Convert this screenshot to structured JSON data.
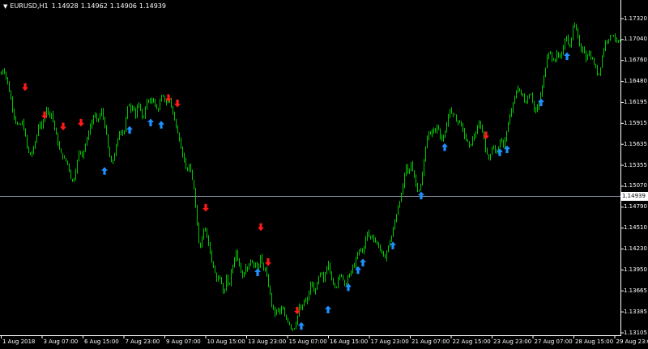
{
  "header": {
    "symbol": "EURUSD,H1",
    "open": "1.14928",
    "high": "1.14962",
    "low": "1.14906",
    "close": "1.14939"
  },
  "colors": {
    "background": "#000000",
    "candles": "#00c800",
    "bid_line": "#8a93a8",
    "sell_arrow": "#ff1a1a",
    "buy_arrow": "#1e90ff",
    "axis_text": "#ffffff"
  },
  "bid_price_label": "1.14939",
  "chart_data": {
    "type": "line",
    "x_tick_labels": [
      "1 Aug 2018",
      "3 Aug 07:00",
      "6 Aug 15:00",
      "7 Aug 23:00",
      "9 Aug 07:00",
      "10 Aug 15:00",
      "13 Aug 23:00",
      "15 Aug 07:00",
      "16 Aug 15:00",
      "17 Aug 23:00",
      "21 Aug 07:00",
      "22 Aug 15:00",
      "23 Aug 23:00",
      "27 Aug 07:00",
      "28 Aug 15:00",
      "29 Aug 23:00"
    ],
    "y_tick_labels": [
      "1.17320",
      "1.17040",
      "1.16760",
      "1.16480",
      "1.16195",
      "1.15915",
      "1.15635",
      "1.15355",
      "1.15070",
      "1.14790",
      "1.14510",
      "1.14230",
      "1.13950",
      "1.13665",
      "1.13385",
      "1.13105"
    ],
    "ylim": [
      1.13105,
      1.1732
    ],
    "bid_line": 1.14939,
    "price_path": [
      [
        0,
        1.1657
      ],
      [
        4,
        1.1665
      ],
      [
        8,
        1.165
      ],
      [
        12,
        1.163
      ],
      [
        16,
        1.1605
      ],
      [
        20,
        1.159
      ],
      [
        24,
        1.1588
      ],
      [
        27,
        1.1593
      ],
      [
        30,
        1.158
      ],
      [
        33,
        1.156
      ],
      [
        36,
        1.1548
      ],
      [
        39,
        1.1552
      ],
      [
        42,
        1.1562
      ],
      [
        45,
        1.1575
      ],
      [
        48,
        1.1595
      ],
      [
        51,
        1.1585
      ],
      [
        54,
        1.1598
      ],
      [
        57,
        1.1613
      ],
      [
        60,
        1.1602
      ],
      [
        63,
        1.1605
      ],
      [
        66,
        1.159
      ],
      [
        70,
        1.157
      ],
      [
        74,
        1.1552
      ],
      [
        78,
        1.1545
      ],
      [
        82,
        1.154
      ],
      [
        85,
        1.153
      ],
      [
        88,
        1.1512
      ],
      [
        91,
        1.1518
      ],
      [
        94,
        1.1535
      ],
      [
        98,
        1.1558
      ],
      [
        101,
        1.1548
      ],
      [
        104,
        1.156
      ],
      [
        107,
        1.157
      ],
      [
        110,
        1.1585
      ],
      [
        113,
        1.1593
      ],
      [
        116,
        1.1605
      ],
      [
        119,
        1.1595
      ],
      [
        122,
        1.16
      ],
      [
        125,
        1.1608
      ],
      [
        128,
        1.1595
      ],
      [
        131,
        1.1575
      ],
      [
        134,
        1.155
      ],
      [
        137,
        1.1538
      ],
      [
        140,
        1.1545
      ],
      [
        143,
        1.156
      ],
      [
        146,
        1.1575
      ],
      [
        149,
        1.1583
      ],
      [
        152,
        1.1575
      ],
      [
        155,
        1.1598
      ],
      [
        158,
        1.162
      ],
      [
        161,
        1.161
      ],
      [
        164,
        1.1618
      ],
      [
        167,
        1.16
      ],
      [
        170,
        1.1618
      ],
      [
        173,
        1.161
      ],
      [
        176,
        1.1595
      ],
      [
        179,
        1.1612
      ],
      [
        182,
        1.1625
      ],
      [
        185,
        1.1618
      ],
      [
        188,
        1.1628
      ],
      [
        191,
        1.1615
      ],
      [
        194,
        1.1608
      ],
      [
        197,
        1.162
      ],
      [
        200,
        1.163
      ],
      [
        203,
        1.1622
      ],
      [
        206,
        1.1618
      ],
      [
        209,
        1.1625
      ],
      [
        212,
        1.161
      ],
      [
        215,
        1.1595
      ],
      [
        218,
        1.1585
      ],
      [
        221,
        1.157
      ],
      [
        224,
        1.1555
      ],
      [
        227,
        1.154
      ],
      [
        230,
        1.1525
      ],
      [
        233,
        1.1535
      ],
      [
        236,
        1.152
      ],
      [
        239,
        1.1505
      ],
      [
        242,
        1.147
      ],
      [
        244,
        1.1445
      ],
      [
        246,
        1.142
      ],
      [
        249,
        1.144
      ],
      [
        252,
        1.1455
      ],
      [
        255,
        1.144
      ],
      [
        258,
        1.1425
      ],
      [
        261,
        1.1405
      ],
      [
        264,
        1.1395
      ],
      [
        267,
        1.138
      ],
      [
        270,
        1.139
      ],
      [
        273,
        1.1375
      ],
      [
        276,
        1.136
      ],
      [
        279,
        1.1385
      ],
      [
        282,
        1.137
      ],
      [
        285,
        1.1392
      ],
      [
        288,
        1.1405
      ],
      [
        291,
        1.142
      ],
      [
        294,
        1.1405
      ],
      [
        297,
        1.1395
      ],
      [
        300,
        1.1385
      ],
      [
        303,
        1.14
      ],
      [
        306,
        1.1395
      ],
      [
        309,
        1.141
      ],
      [
        312,
        1.1398
      ],
      [
        315,
        1.1405
      ],
      [
        318,
        1.1395
      ],
      [
        321,
        1.1412
      ],
      [
        324,
        1.1398
      ],
      [
        327,
        1.1395
      ],
      [
        330,
        1.138
      ],
      [
        333,
        1.1362
      ],
      [
        336,
        1.1343
      ],
      [
        339,
        1.1336
      ],
      [
        342,
        1.1343
      ],
      [
        345,
        1.1338
      ],
      [
        348,
        1.1345
      ],
      [
        351,
        1.1332
      ],
      [
        354,
        1.1328
      ],
      [
        357,
        1.1322
      ],
      [
        360,
        1.1315
      ],
      [
        363,
        1.1318
      ],
      [
        366,
        1.1328
      ],
      [
        369,
        1.1345
      ],
      [
        372,
        1.134
      ],
      [
        375,
        1.1355
      ],
      [
        378,
        1.135
      ],
      [
        381,
        1.1365
      ],
      [
        384,
        1.138
      ],
      [
        387,
        1.1365
      ],
      [
        390,
        1.1372
      ],
      [
        393,
        1.1385
      ],
      [
        396,
        1.1392
      ],
      [
        399,
        1.138
      ],
      [
        402,
        1.1395
      ],
      [
        405,
        1.1405
      ],
      [
        408,
        1.1388
      ],
      [
        411,
        1.1375
      ],
      [
        414,
        1.1368
      ],
      [
        417,
        1.1385
      ],
      [
        420,
        1.1392
      ],
      [
        423,
        1.138
      ],
      [
        426,
        1.1372
      ],
      [
        429,
        1.1385
      ],
      [
        432,
        1.139
      ],
      [
        435,
        1.1398
      ],
      [
        438,
        1.1405
      ],
      [
        441,
        1.1415
      ],
      [
        444,
        1.1425
      ],
      [
        447,
        1.1418
      ],
      [
        450,
        1.1432
      ],
      [
        453,
        1.1445
      ],
      [
        456,
        1.1438
      ],
      [
        459,
        1.144
      ],
      [
        462,
        1.1435
      ],
      [
        465,
        1.143
      ],
      [
        468,
        1.1425
      ],
      [
        471,
        1.1418
      ],
      [
        474,
        1.1408
      ],
      [
        477,
        1.142
      ],
      [
        480,
        1.143
      ],
      [
        483,
        1.144
      ],
      [
        486,
        1.1455
      ],
      [
        489,
        1.147
      ],
      [
        492,
        1.1485
      ],
      [
        495,
        1.1495
      ],
      [
        498,
        1.1515
      ],
      [
        501,
        1.1535
      ],
      [
        504,
        1.1522
      ],
      [
        507,
        1.1538
      ],
      [
        510,
        1.1525
      ],
      [
        513,
        1.151
      ],
      [
        516,
        1.15
      ],
      [
        519,
        1.1508
      ],
      [
        522,
        1.153
      ],
      [
        525,
        1.156
      ],
      [
        528,
        1.158
      ],
      [
        531,
        1.1575
      ],
      [
        534,
        1.1585
      ],
      [
        537,
        1.158
      ],
      [
        540,
        1.159
      ],
      [
        543,
        1.1575
      ],
      [
        546,
        1.1568
      ],
      [
        549,
        1.1578
      ],
      [
        552,
        1.1595
      ],
      [
        555,
        1.1612
      ],
      [
        558,
        1.16
      ],
      [
        561,
        1.1605
      ],
      [
        564,
        1.159
      ],
      [
        567,
        1.1595
      ],
      [
        570,
        1.1585
      ],
      [
        573,
        1.1575
      ],
      [
        576,
        1.1568
      ],
      [
        579,
        1.156
      ],
      [
        582,
        1.1568
      ],
      [
        585,
        1.1575
      ],
      [
        588,
        1.158
      ],
      [
        591,
        1.1592
      ],
      [
        594,
        1.1585
      ],
      [
        597,
        1.1572
      ],
      [
        600,
        1.155
      ],
      [
        603,
        1.1545
      ],
      [
        606,
        1.1555
      ],
      [
        609,
        1.1562
      ],
      [
        612,
        1.155
      ],
      [
        615,
        1.156
      ],
      [
        618,
        1.157
      ],
      [
        621,
        1.1562
      ],
      [
        624,
        1.1575
      ],
      [
        627,
        1.159
      ],
      [
        630,
        1.1605
      ],
      [
        633,
        1.1618
      ],
      [
        636,
        1.163
      ],
      [
        639,
        1.164
      ],
      [
        642,
        1.1632
      ],
      [
        645,
        1.1628
      ],
      [
        648,
        1.1618
      ],
      [
        651,
        1.1625
      ],
      [
        654,
        1.1635
      ],
      [
        657,
        1.1622
      ],
      [
        660,
        1.1605
      ],
      [
        663,
        1.1612
      ],
      [
        666,
        1.1625
      ],
      [
        669,
        1.164
      ],
      [
        672,
        1.166
      ],
      [
        675,
        1.1682
      ],
      [
        678,
        1.169
      ],
      [
        681,
        1.1678
      ],
      [
        684,
        1.1672
      ],
      [
        687,
        1.1688
      ],
      [
        690,
        1.1678
      ],
      [
        693,
        1.1685
      ],
      [
        696,
        1.17
      ],
      [
        699,
        1.1708
      ],
      [
        702,
        1.169
      ],
      [
        705,
        1.1705
      ],
      [
        708,
        1.173
      ],
      [
        711,
        1.1718
      ],
      [
        714,
        1.17
      ],
      [
        717,
        1.1688
      ],
      [
        720,
        1.1692
      ],
      [
        723,
        1.1678
      ],
      [
        726,
        1.1688
      ],
      [
        729,
        1.168
      ],
      [
        732,
        1.1675
      ],
      [
        735,
        1.1665
      ],
      [
        738,
        1.1655
      ],
      [
        741,
        1.1668
      ],
      [
        744,
        1.1688
      ],
      [
        747,
        1.17
      ],
      [
        750,
        1.1705
      ],
      [
        753,
        1.1708
      ],
      [
        756,
        1.1712
      ],
      [
        759,
        1.1705
      ],
      [
        762,
        1.17
      ],
      [
        765,
        1.1702
      ]
    ],
    "sell_signals": [
      [
        31,
        1.164
      ],
      [
        55,
        1.1602
      ],
      [
        78,
        1.1587
      ],
      [
        100,
        1.1592
      ],
      [
        208,
        1.1625
      ],
      [
        219,
        1.1618
      ],
      [
        254,
        1.1478
      ],
      [
        322,
        1.1452
      ],
      [
        331,
        1.1405
      ],
      [
        367,
        1.134
      ],
      [
        600,
        1.1575
      ]
    ],
    "buy_signals": [
      [
        129,
        1.1528
      ],
      [
        160,
        1.1583
      ],
      [
        186,
        1.1593
      ],
      [
        199,
        1.159
      ],
      [
        318,
        1.1392
      ],
      [
        372,
        1.132
      ],
      [
        405,
        1.1342
      ],
      [
        430,
        1.1372
      ],
      [
        442,
        1.1395
      ],
      [
        448,
        1.1405
      ],
      [
        485,
        1.1428
      ],
      [
        520,
        1.1495
      ],
      [
        549,
        1.156
      ],
      [
        617,
        1.1553
      ],
      [
        626,
        1.1557
      ],
      [
        668,
        1.162
      ],
      [
        700,
        1.1682
      ]
    ]
  }
}
